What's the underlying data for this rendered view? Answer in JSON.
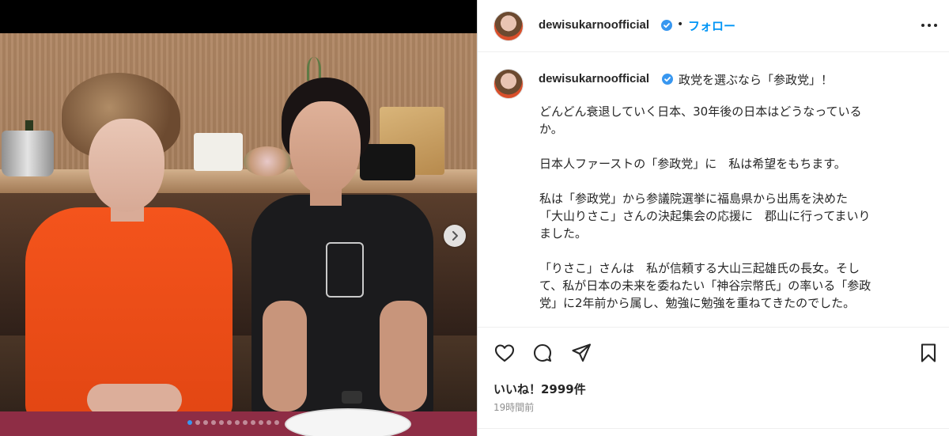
{
  "post": {
    "username": "dewisukarnoofficial",
    "follow_label": "フォロー",
    "separator": "•",
    "caption_title": "政党を選ぶなら「参政党」！",
    "caption_body": "どんどん衰退していく日本、30年後の日本はどうなっている\nか。\n\n日本人ファーストの「参政党」に　私は希望をもちます。\n\n私は「参政党」から参議院選挙に福島県から出馬を決めた\n「大山りさこ」さんの決起集会の応援に　郡山に行ってまいり\nました。\n\n「りさこ」さんは　私が信頼する大山三起雄氏の長女。そし\nて、私が日本の未来を委ねたい「神谷宗幣氏」の率いる「参政\n党」に2年前から属し、勉強に勉強を重ねてきたのでした。",
    "likes_label": "いいね！2999件",
    "time_label": "19時間前"
  },
  "carousel": {
    "dot_count": 12,
    "active_index": 0
  },
  "icons": {
    "verified": "verified-badge-icon",
    "more": "more-options-icon",
    "like": "heart-icon",
    "comment": "comment-icon",
    "share": "share-icon",
    "save": "bookmark-icon",
    "next": "chevron-right-icon"
  },
  "colors": {
    "link_blue": "#0095f6",
    "verified_blue": "#3897f0",
    "text": "#262626",
    "muted": "#8e8e8e"
  }
}
